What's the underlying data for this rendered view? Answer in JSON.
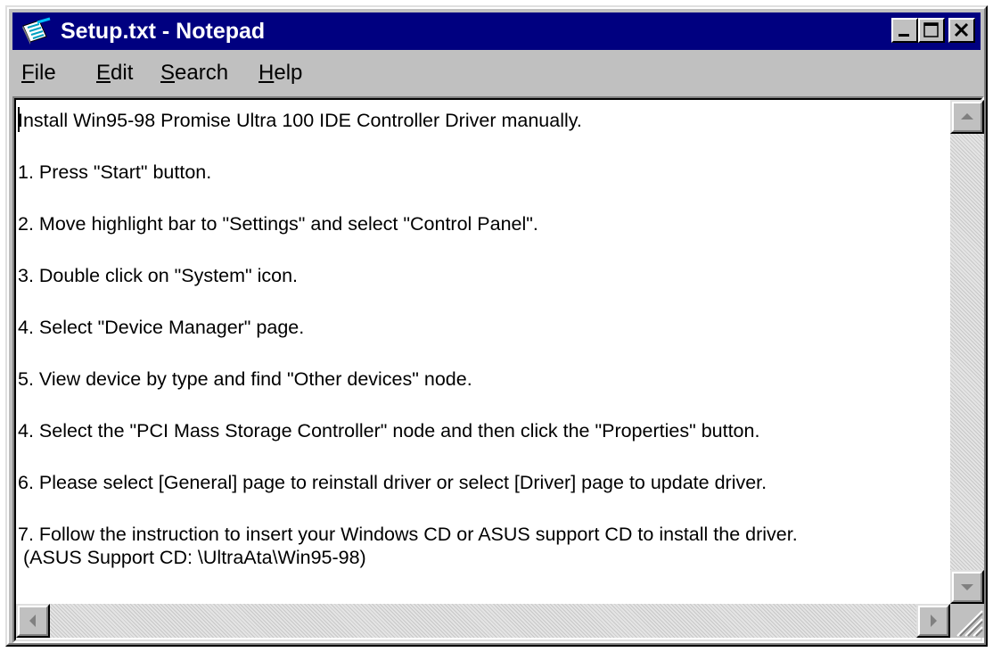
{
  "window": {
    "title": "Setup.txt - Notepad",
    "titlebar_color": "#000080"
  },
  "titlebar_buttons": {
    "minimize_icon": "minimize-icon",
    "maximize_icon": "maximize-icon",
    "close_icon": "close-icon"
  },
  "menu": {
    "items": [
      {
        "mnemonic": "F",
        "rest": "ile"
      },
      {
        "mnemonic": "E",
        "rest": "dit"
      },
      {
        "mnemonic": "S",
        "rest": "earch"
      },
      {
        "mnemonic": "H",
        "rest": "elp"
      }
    ]
  },
  "document": {
    "lines": [
      "Install Win95-98 Promise Ultra 100 IDE Controller Driver manually.",
      "1. Press \"Start\" button.",
      "2. Move highlight bar to \"Settings\" and select \"Control Panel\".",
      "3. Double click on \"System\" icon.",
      "4. Select \"Device Manager\" page.",
      "5. View device by type and find \"Other devices\" node.",
      "4. Select the \"PCI Mass Storage Controller\" node and then click the \"Properties\" button.",
      "6. Please select [General] page to reinstall driver or select [Driver] page to update driver.",
      "7. Follow the instruction to insert your Windows CD or ASUS support CD to install the driver.",
      " (ASUS Support CD: \\UltraAta\\Win95-98)"
    ]
  }
}
